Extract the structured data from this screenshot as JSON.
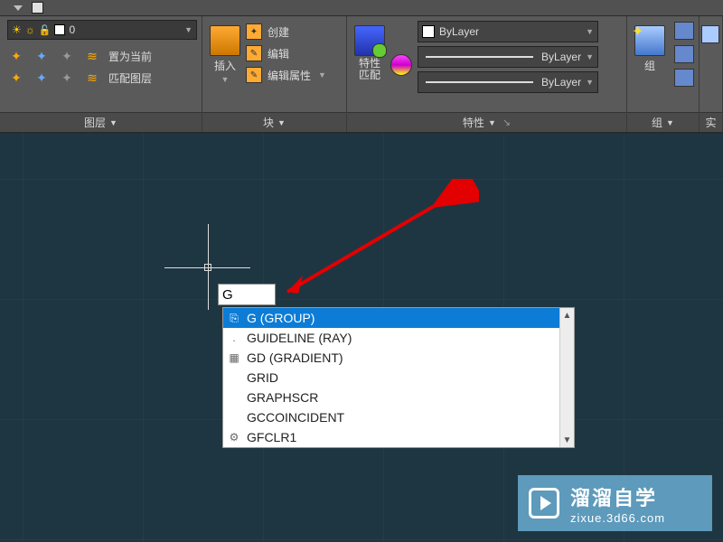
{
  "ribbon": {
    "layer": {
      "current": "0",
      "set_current": "置为当前",
      "match_layer": "匹配图层",
      "title": "图层"
    },
    "block": {
      "insert": "插入",
      "create": "创建",
      "edit": "编辑",
      "edit_attr": "编辑属性",
      "title": "块"
    },
    "properties": {
      "match": "特性\n匹配",
      "bylayer1": "ByLayer",
      "bylayer2": "ByLayer",
      "bylayer3": "ByLayer",
      "title": "特性"
    },
    "group": {
      "label": "组",
      "title": "组"
    },
    "util": {
      "title": "实"
    }
  },
  "command": {
    "input": "G",
    "suggestions": [
      {
        "icon": "⎘",
        "text": "G (GROUP)",
        "selected": true
      },
      {
        "icon": ".",
        "text": "GUIDELINE (RAY)",
        "selected": false
      },
      {
        "icon": "▦",
        "text": "GD (GRADIENT)",
        "selected": false
      },
      {
        "icon": "",
        "text": "GRID",
        "selected": false
      },
      {
        "icon": "",
        "text": "GRAPHSCR",
        "selected": false
      },
      {
        "icon": "",
        "text": "GCCOINCIDENT",
        "selected": false
      },
      {
        "icon": "⚙",
        "text": "GFCLR1",
        "selected": false
      }
    ]
  },
  "watermark": {
    "title": "溜溜自学",
    "url": "zixue.3d66.com"
  }
}
